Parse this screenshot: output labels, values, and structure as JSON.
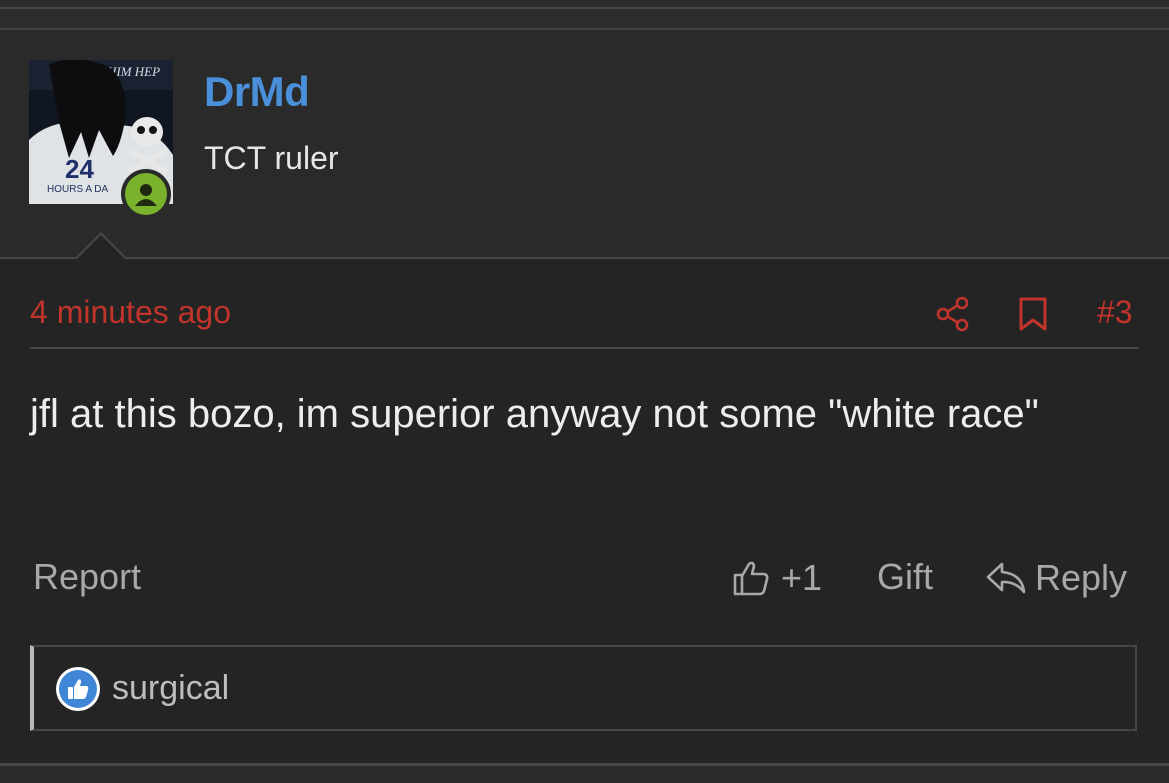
{
  "user": {
    "name": "DrMd",
    "title": "TCT ruler",
    "avatar": {
      "shirt_number": "24",
      "shirt_text": "HOURS A DA",
      "banner_text": "HIM HEP"
    },
    "online": true
  },
  "post": {
    "timestamp": "4 minutes ago",
    "number": "#3",
    "body": "jfl at this bozo, im superior anyway not some \"white race\""
  },
  "actions": {
    "report_label": "Report",
    "like_count": "+1",
    "gift_label": "Gift",
    "reply_label": "Reply"
  },
  "reactions": {
    "icon": "thumbs-up-icon",
    "users": "surgical"
  },
  "colors": {
    "username": "#4a8fd9",
    "accent_red": "#c0342c",
    "online_green": "#7bb22c",
    "reaction_blue": "#3f86d6"
  }
}
